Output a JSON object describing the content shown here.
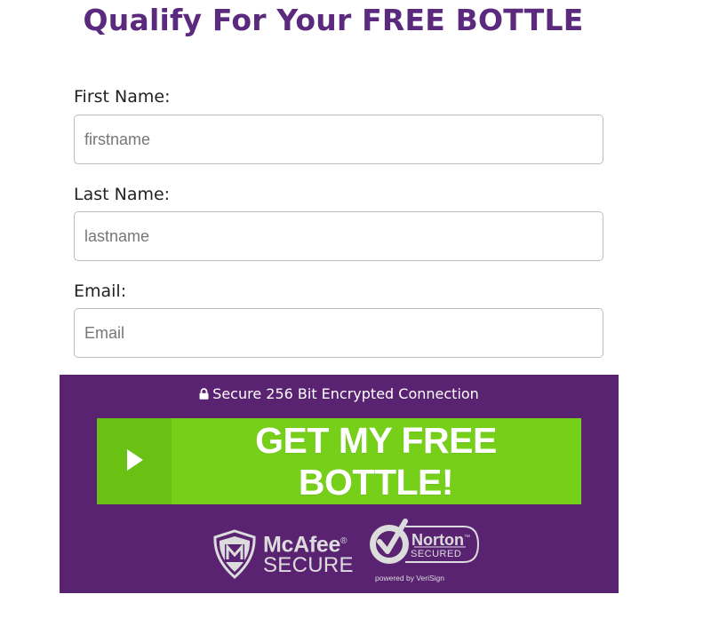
{
  "header": {
    "title": "Qualify For Your FREE BOTTLE"
  },
  "form": {
    "first_name": {
      "label": "First Name:",
      "placeholder": "firstname",
      "value": ""
    },
    "last_name": {
      "label": "Last Name:",
      "placeholder": "lastname",
      "value": ""
    },
    "email": {
      "label": "Email:",
      "placeholder": "Email",
      "value": ""
    }
  },
  "panel": {
    "background_color": "#5a2372",
    "secure_text": "Secure 256 Bit Encrypted Connection",
    "secure_icon": "lock-icon",
    "cta": {
      "label": "GET MY FREE BOTTLE!",
      "icon": "play-icon",
      "color": "#76d01a"
    },
    "badges": {
      "mcafee": {
        "brand": "McAfee",
        "registered": "®",
        "sub": "SECURE",
        "icon": "mcafee-shield-icon"
      },
      "norton": {
        "brand": "Norton",
        "trademark": "™",
        "sub": "SECURED",
        "powered": "powered by VeriSign",
        "icon": "norton-check-icon"
      }
    }
  },
  "colors": {
    "title": "#5b2a7f",
    "panel": "#5a2372",
    "cta": "#76d01a"
  }
}
